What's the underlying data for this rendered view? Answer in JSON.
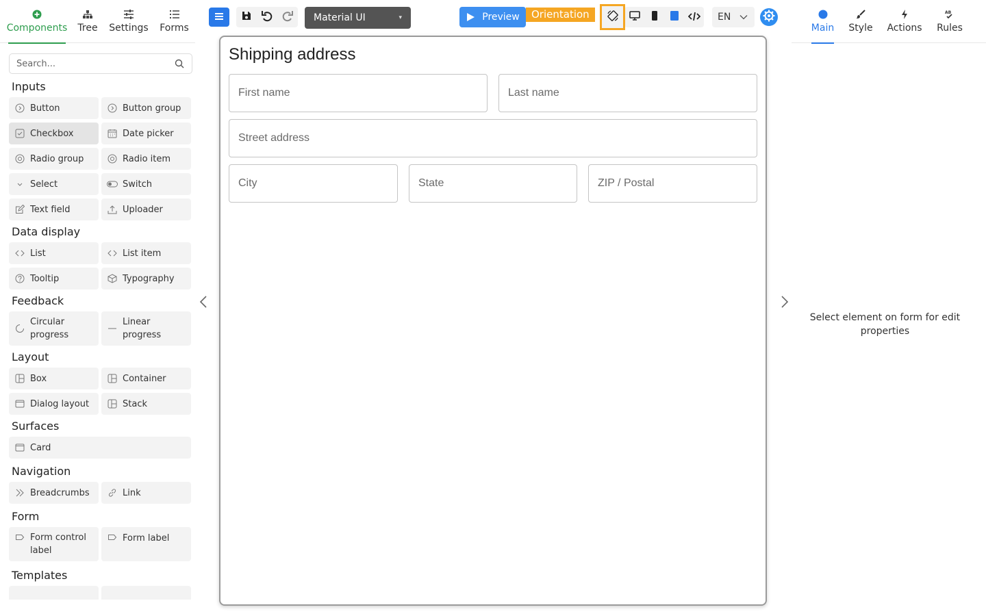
{
  "left_panel": {
    "tabs": [
      {
        "label": "Components",
        "icon": "plus-circle-icon",
        "active": true
      },
      {
        "label": "Tree",
        "icon": "tree-icon",
        "active": false
      },
      {
        "label": "Settings",
        "icon": "sliders-icon",
        "active": false
      },
      {
        "label": "Forms",
        "icon": "list-icon",
        "active": false
      }
    ],
    "search": {
      "placeholder": "Search..."
    },
    "sections": [
      {
        "title": "Inputs",
        "items": [
          {
            "label": "Button",
            "icon": "button-icon"
          },
          {
            "label": "Button group",
            "icon": "button-group-icon"
          },
          {
            "label": "Checkbox",
            "icon": "checkbox-icon",
            "selected": true
          },
          {
            "label": "Date picker",
            "icon": "calendar-icon"
          },
          {
            "label": "Radio group",
            "icon": "radio-icon"
          },
          {
            "label": "Radio item",
            "icon": "radio-icon"
          },
          {
            "label": "Select",
            "icon": "chevron-down-icon"
          },
          {
            "label": "Switch",
            "icon": "toggle-icon"
          },
          {
            "label": "Text field",
            "icon": "edit-icon"
          },
          {
            "label": "Uploader",
            "icon": "upload-icon"
          }
        ]
      },
      {
        "title": "Data display",
        "items": [
          {
            "label": "List",
            "icon": "code-icon"
          },
          {
            "label": "List item",
            "icon": "code-icon"
          },
          {
            "label": "Tooltip",
            "icon": "question-icon"
          },
          {
            "label": "Typography",
            "icon": "cube-icon"
          }
        ]
      },
      {
        "title": "Feedback",
        "items": [
          {
            "label": "Circular progress",
            "icon": "circular-progress-icon"
          },
          {
            "label": "Linear progress",
            "icon": "linear-progress-icon"
          }
        ]
      },
      {
        "title": "Layout",
        "items": [
          {
            "label": "Box",
            "icon": "layout-icon"
          },
          {
            "label": "Container",
            "icon": "layout-icon"
          },
          {
            "label": "Dialog layout",
            "icon": "window-icon"
          },
          {
            "label": "Stack",
            "icon": "layout-icon"
          }
        ]
      },
      {
        "title": "Surfaces",
        "items": [
          {
            "label": "Card",
            "icon": "window-icon"
          }
        ]
      },
      {
        "title": "Navigation",
        "items": [
          {
            "label": "Breadcrumbs",
            "icon": "double-chevron-icon"
          },
          {
            "label": "Link",
            "icon": "link-icon"
          }
        ]
      },
      {
        "title": "Form",
        "items": [
          {
            "label": "Form control label",
            "icon": "tag-icon"
          },
          {
            "label": "Form label",
            "icon": "tag-icon"
          }
        ]
      },
      {
        "title": "Templates",
        "items": []
      }
    ]
  },
  "toolbar": {
    "library": "Material UI",
    "preview_label": "Preview",
    "orientation_label": "Orientation",
    "language": "EN",
    "accent": "#2979e8",
    "highlight": "#f5a623"
  },
  "form": {
    "title": "Shipping address",
    "fields": {
      "first_name": "First name",
      "last_name": "Last name",
      "street": "Street address",
      "city": "City",
      "state": "State",
      "zip": "ZIP / Postal"
    }
  },
  "right_panel": {
    "tabs": [
      {
        "label": "Main",
        "icon": "dot-icon",
        "active": true
      },
      {
        "label": "Style",
        "icon": "brush-icon",
        "active": false
      },
      {
        "label": "Actions",
        "icon": "bolt-icon",
        "active": false
      },
      {
        "label": "Rules",
        "icon": "spellcheck-icon",
        "active": false
      }
    ],
    "empty_message": "Select element on form for edit properties"
  }
}
